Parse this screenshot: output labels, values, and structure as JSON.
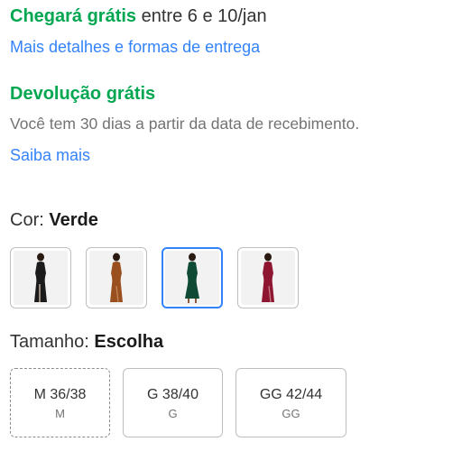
{
  "shipping": {
    "highlight": "Chegará grátis",
    "rest": " entre 6 e 10/jan",
    "link": "Mais detalhes e formas de entrega"
  },
  "returns": {
    "title": "Devolução grátis",
    "description": "Você tem 30 dias a partir da data de recebimento.",
    "link": "Saiba mais"
  },
  "color": {
    "label": "Cor: ",
    "value": "Verde",
    "options": [
      {
        "icon": "dress-black-image",
        "dress_color": "#1b1b1b",
        "selected": false
      },
      {
        "icon": "dress-caramel-image",
        "dress_color": "#9a4f1f",
        "selected": false
      },
      {
        "icon": "dress-green-image",
        "dress_color": "#0f4a35",
        "selected": true
      },
      {
        "icon": "dress-wine-image",
        "dress_color": "#8e1630",
        "selected": false
      }
    ]
  },
  "size": {
    "label": "Tamanho: ",
    "value": "Escolha",
    "options": [
      {
        "main": "M 36/38",
        "sub": "M"
      },
      {
        "main": "G 38/40",
        "sub": "G"
      },
      {
        "main": "GG 42/44",
        "sub": "GG"
      }
    ]
  },
  "colors": {
    "green": "#00a650",
    "link": "#3483fa",
    "selected_border": "#3483fa"
  }
}
